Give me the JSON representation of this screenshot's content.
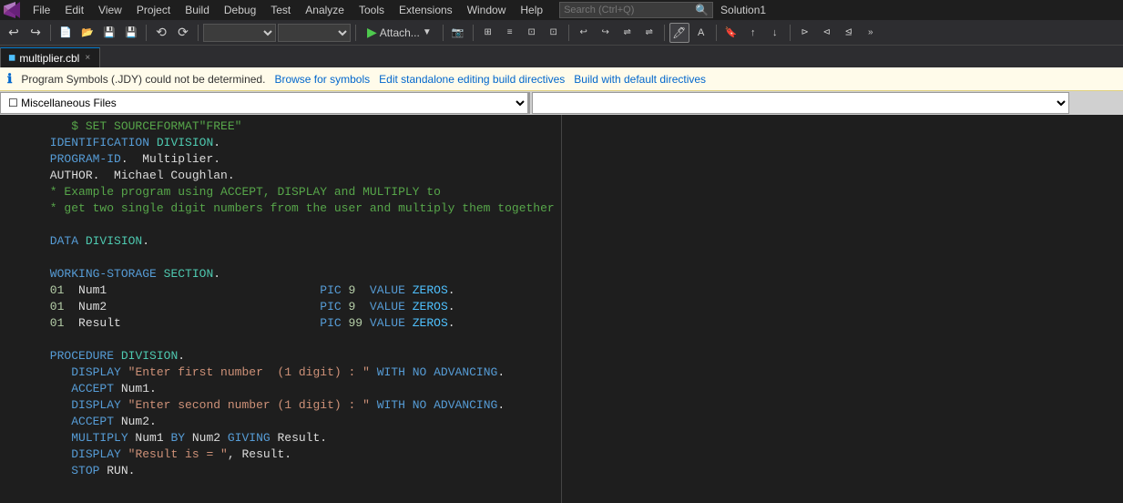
{
  "app": {
    "logo": "VS",
    "solution": "Solution1"
  },
  "menu": {
    "items": [
      "File",
      "Edit",
      "View",
      "Project",
      "Build",
      "Debug",
      "Test",
      "Analyze",
      "Tools",
      "Extensions",
      "Window",
      "Help"
    ]
  },
  "search": {
    "placeholder": "Search (Ctrl+Q)"
  },
  "tab": {
    "filename": "multiplier.cbl",
    "modified": "",
    "close": "×"
  },
  "info_bar": {
    "icon": "ℹ",
    "message": "Program Symbols (.JDY) could not be determined.",
    "browse_link": "Browse for symbols",
    "edit_link": "Edit standalone editing build directives",
    "build_link": "Build with default directives"
  },
  "dropdown_bar": {
    "left_value": "☐ Miscellaneous Files",
    "right_value": ""
  },
  "code": {
    "lines": [
      {
        "indent": "         ",
        "content": "$ SET SOURCEFORMAT\"FREE\"",
        "type": "comment_green"
      },
      {
        "indent": "      ",
        "content": "IDENTIFICATION DIVISION.",
        "type": "mixed"
      },
      {
        "indent": "      ",
        "content": "PROGRAM-ID.  Multiplier.",
        "type": "mixed"
      },
      {
        "indent": "      ",
        "content": "AUTHOR.  Michael Coughlan.",
        "type": "plain"
      },
      {
        "indent": "      ",
        "content": "* Example program using ACCEPT, DISPLAY and MULTIPLY to",
        "type": "comment_green"
      },
      {
        "indent": "      ",
        "content": "* get two single digit numbers from the user and multiply them together",
        "type": "comment_green"
      },
      {
        "indent": "",
        "content": "",
        "type": "empty"
      },
      {
        "indent": "      ",
        "content": "DATA DIVISION.",
        "type": "mixed"
      },
      {
        "indent": "",
        "content": "",
        "type": "empty"
      },
      {
        "indent": "      ",
        "content": "WORKING-STORAGE SECTION.",
        "type": "mixed"
      },
      {
        "indent": "      ",
        "content": "01  Num1                              PIC 9  VALUE ZEROS.",
        "type": "data_line"
      },
      {
        "indent": "      ",
        "content": "01  Num2                              PIC 9  VALUE ZEROS.",
        "type": "data_line"
      },
      {
        "indent": "      ",
        "content": "01  Result                            PIC 99 VALUE ZEROS.",
        "type": "data_line"
      },
      {
        "indent": "",
        "content": "",
        "type": "empty"
      },
      {
        "indent": "      ",
        "content": "PROCEDURE DIVISION.",
        "type": "mixed"
      },
      {
        "indent": "         ",
        "content": "DISPLAY \"Enter first number  (1 digit) : \" WITH NO ADVANCING.",
        "type": "proc_line"
      },
      {
        "indent": "         ",
        "content": "ACCEPT Num1.",
        "type": "proc_plain"
      },
      {
        "indent": "         ",
        "content": "DISPLAY \"Enter second number (1 digit) : \" WITH NO ADVANCING.",
        "type": "proc_line"
      },
      {
        "indent": "         ",
        "content": "ACCEPT Num2.",
        "type": "proc_plain"
      },
      {
        "indent": "         ",
        "content": "MULTIPLY Num1 BY Num2 GIVING Result.",
        "type": "proc_kw"
      },
      {
        "indent": "         ",
        "content": "DISPLAY \"Result is = \", Result.",
        "type": "proc_line2"
      },
      {
        "indent": "         ",
        "content": "STOP RUN.",
        "type": "proc_stop"
      }
    ]
  }
}
